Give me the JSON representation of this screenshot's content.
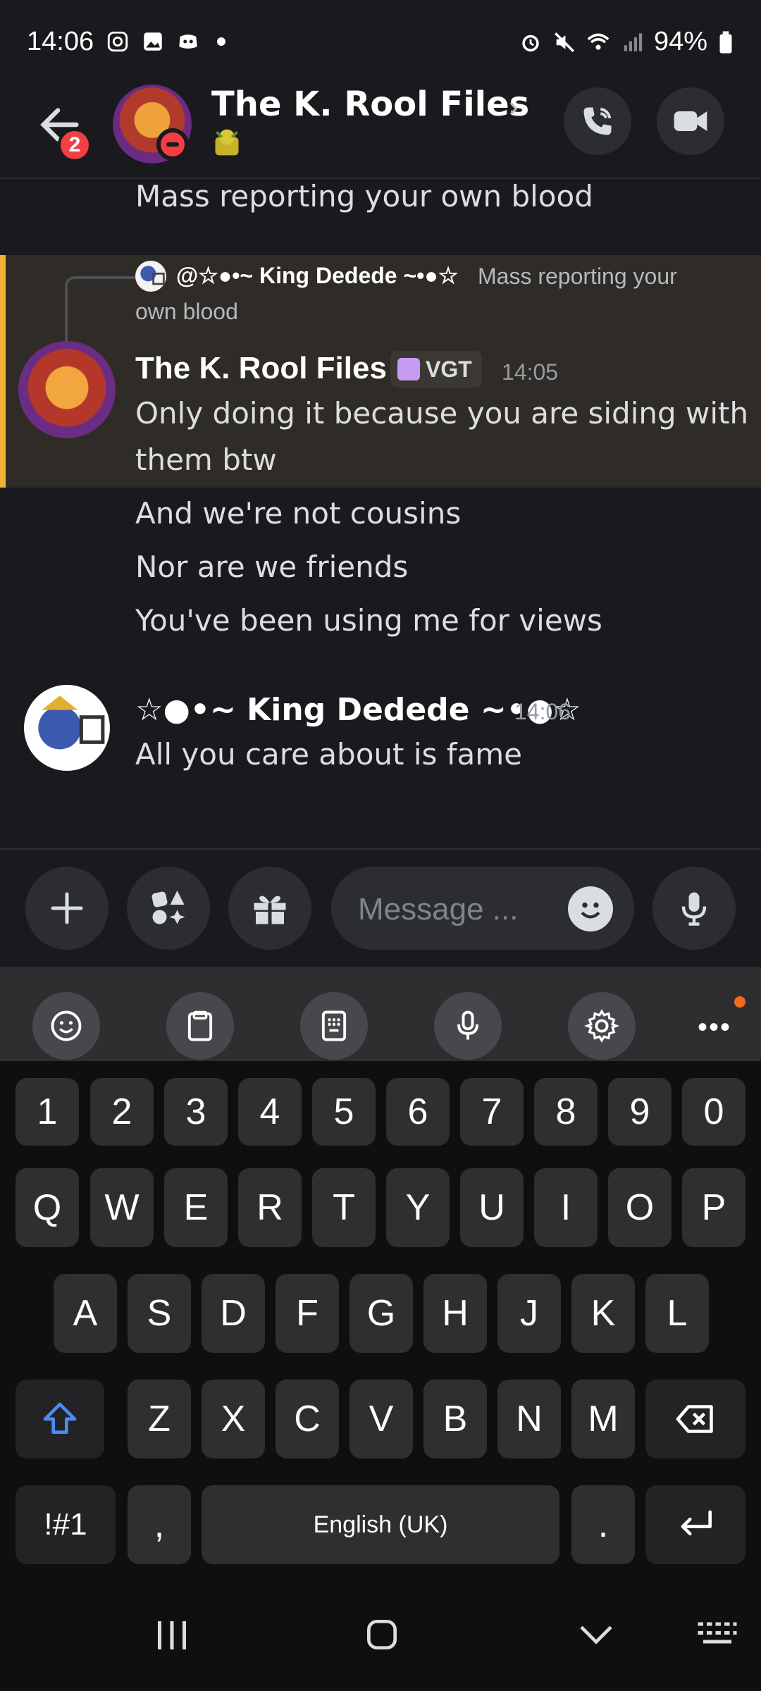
{
  "status_bar": {
    "time": "14:06",
    "battery": "94%"
  },
  "header": {
    "title": "The K. Rool Files",
    "unread_badge": "2"
  },
  "chat": {
    "top_line": "Mass reporting your own blood",
    "highlighted_message": {
      "reply_to_name": "@☆●•~ King Dedede ~•●☆",
      "reply_text_line1": "Mass reporting your",
      "reply_text_line2": "own blood",
      "author": "The K. Rool Files",
      "badge": "VGT",
      "time": "14:05",
      "line1": "Only doing it because you are siding with",
      "line2": "them btw"
    },
    "followups": [
      "And we're not cousins",
      "Nor are we friends",
      "You've been using me for views"
    ],
    "last_message": {
      "author": "☆●•~ King Dedede ~•●☆",
      "time": "14:06",
      "text": "All you care about is fame"
    }
  },
  "input": {
    "placeholder": "Message ..."
  },
  "keyboard": {
    "row_numbers": [
      "1",
      "2",
      "3",
      "4",
      "5",
      "6",
      "7",
      "8",
      "9",
      "0"
    ],
    "row1": [
      "Q",
      "W",
      "E",
      "R",
      "T",
      "Y",
      "U",
      "I",
      "O",
      "P"
    ],
    "row2": [
      "A",
      "S",
      "D",
      "F",
      "G",
      "H",
      "J",
      "K",
      "L"
    ],
    "row3": [
      "Z",
      "X",
      "C",
      "V",
      "B",
      "N",
      "M"
    ],
    "symbols_key": "!#1",
    "comma_key": ",",
    "space_label": "English (UK)",
    "period_key": "."
  },
  "colors": {
    "accent_mention": "#f0b232",
    "dnd": "#f23f43",
    "shift_blue": "#4c8bf5"
  }
}
